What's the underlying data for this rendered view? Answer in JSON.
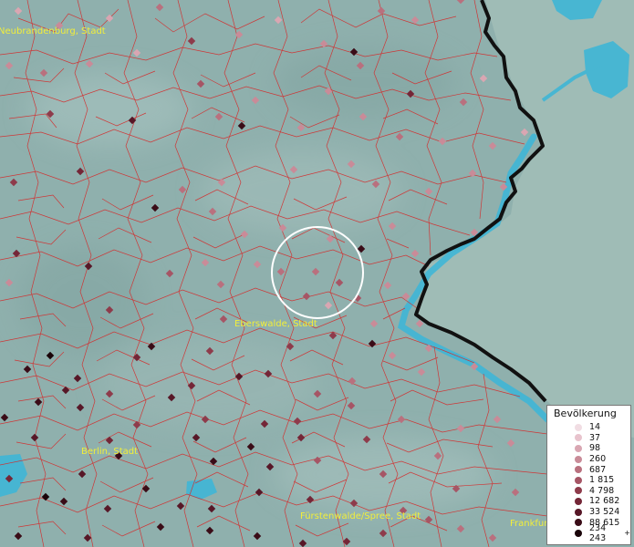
{
  "map": {
    "places": [
      {
        "id": "neubrandenburg",
        "label": "Neubrandenburg, Stadt"
      },
      {
        "id": "eberswalde",
        "label": "Eberswalde, Stadt"
      },
      {
        "id": "berlin",
        "label": "Berlin, Stadt"
      },
      {
        "id": "fuerstenwalde",
        "label": "Fürstenwalde/Spree, Stadt"
      },
      {
        "id": "frankfurt",
        "label": "Frankfurt"
      }
    ],
    "colors": {
      "land": "#8fb0ad",
      "foreign_land": "#9fbcb6",
      "water": "#3fb6d6",
      "border_national": "#111111",
      "municipality_lines": "#d42b2b",
      "selection_circle": "#ffffff",
      "label": "#f2ee3a"
    }
  },
  "legend": {
    "title": "Bevölkerung",
    "classes": [
      {
        "label": "14",
        "color": "#f1dde3"
      },
      {
        "label": "37",
        "color": "#e8c3cd"
      },
      {
        "label": "98",
        "color": "#d9a6b2"
      },
      {
        "label": "260",
        "color": "#c98b98"
      },
      {
        "label": "687",
        "color": "#b9707e"
      },
      {
        "label": "1 815",
        "color": "#a65565"
      },
      {
        "label": "4 798",
        "color": "#8e3b4b"
      },
      {
        "label": "12 682",
        "color": "#742637"
      },
      {
        "label": "33 524",
        "color": "#571727"
      },
      {
        "label": "88 615",
        "color": "#3a0c17"
      },
      {
        "label": "234 243",
        "suffix": "+",
        "color": "#1a0409"
      }
    ]
  }
}
